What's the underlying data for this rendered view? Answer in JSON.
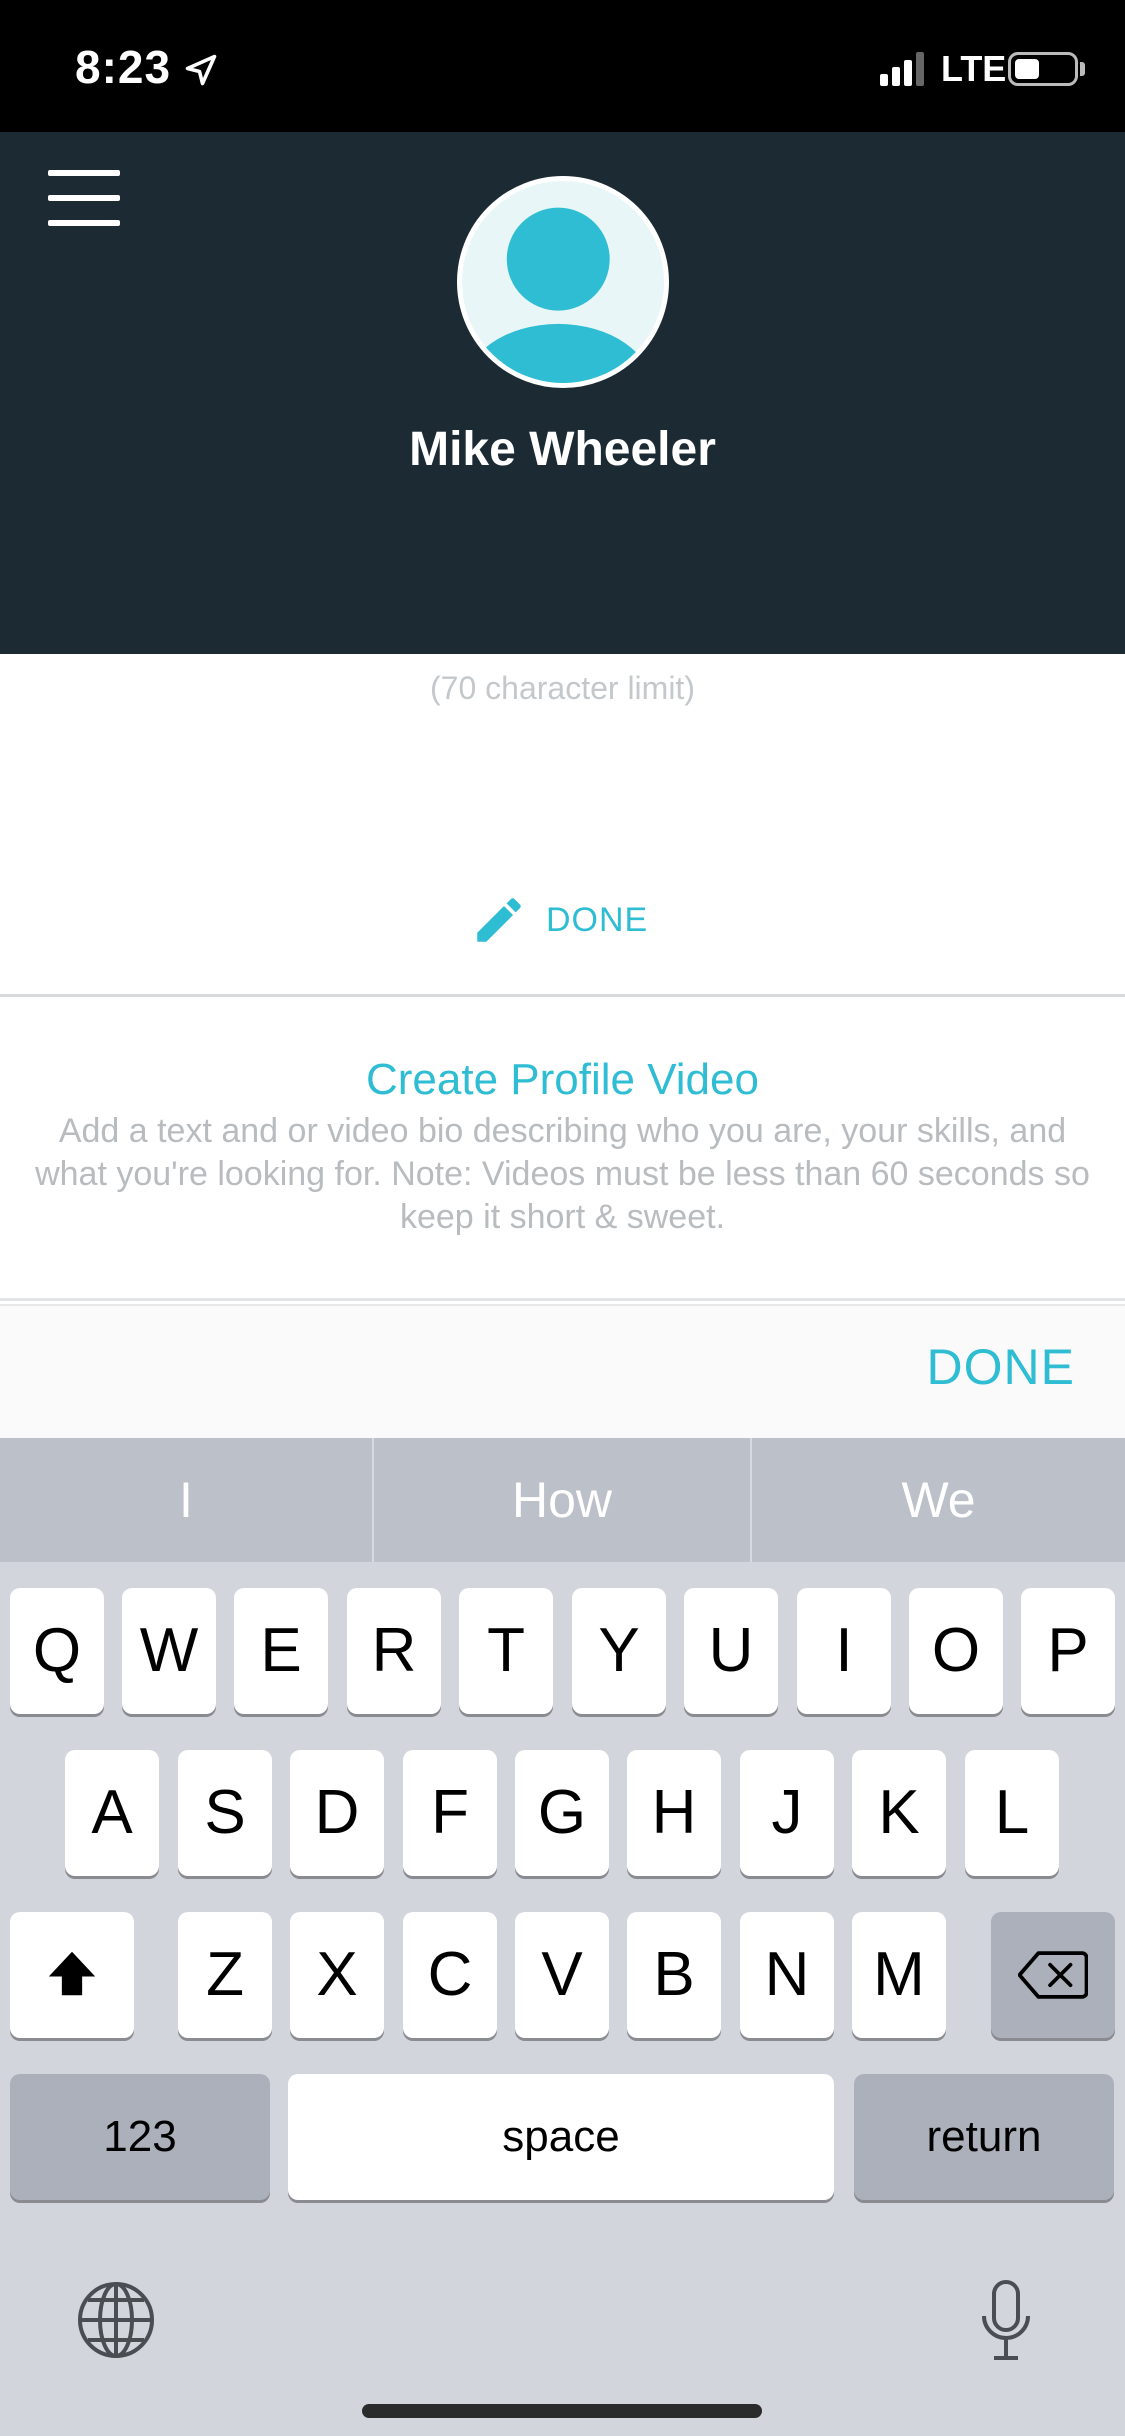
{
  "status_bar": {
    "time": "8:23",
    "network": "LTE"
  },
  "header": {
    "name": "Mike Wheeler"
  },
  "bio": {
    "char_limit_note": "(70 character limit)",
    "edit_done_label": "DONE"
  },
  "video_section": {
    "title": "Create Profile Video",
    "description": "Add a text and or video bio describing who you are, your skills, and what you're looking for. Note: Videos must be less than 60 seconds so keep it short & sweet."
  },
  "accessory": {
    "done_label": "DONE"
  },
  "keyboard": {
    "suggestions": [
      "I",
      "How",
      "We"
    ],
    "row1": [
      "Q",
      "W",
      "E",
      "R",
      "T",
      "Y",
      "U",
      "I",
      "O",
      "P"
    ],
    "row2": [
      "A",
      "S",
      "D",
      "F",
      "G",
      "H",
      "J",
      "K",
      "L"
    ],
    "row3": [
      "Z",
      "X",
      "C",
      "V",
      "B",
      "N",
      "M"
    ],
    "numbers_label": "123",
    "space_label": "space",
    "return_label": "return"
  },
  "icons": {
    "status": [
      "location-arrow-icon",
      "signal-icon",
      "battery-icon"
    ],
    "header": [
      "menu-icon",
      "avatar-icon"
    ],
    "bio": [
      "pencil-icon"
    ],
    "keyboard": [
      "shift-icon",
      "backspace-icon",
      "globe-icon",
      "microphone-icon"
    ]
  },
  "colors": {
    "accent": "#2ebdd3",
    "header_bg": "#1c2b33",
    "muted_text": "#b8bcbf",
    "keyboard_bg": "#d2d5db"
  }
}
